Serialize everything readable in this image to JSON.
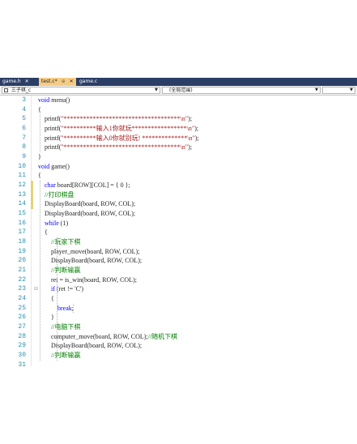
{
  "tabs": [
    {
      "label": "game.h",
      "active": false
    },
    {
      "label": "test.c*",
      "active": true
    },
    {
      "label": "game.c",
      "active": false
    }
  ],
  "nav": {
    "project": "三子棋_c",
    "scope": "(全局范围)",
    "member": ""
  },
  "lines": [
    {
      "n": "3",
      "code": "void menu()"
    },
    {
      "n": "4",
      "code": "{"
    },
    {
      "n": "5",
      "code": "    printf(\"************************************\\n\");"
    },
    {
      "n": "6",
      "code": "    printf(\"**********输入1你就玩*****************\\n\");"
    },
    {
      "n": "7",
      "code": "    printf(\"**********输入0你就别玩! **************\\n\");"
    },
    {
      "n": "8",
      "code": "    printf(\"************************************\\n\");"
    },
    {
      "n": "9",
      "code": "}"
    },
    {
      "n": "10",
      "code": "void game()"
    },
    {
      "n": "11",
      "code": "{"
    },
    {
      "n": "12",
      "code": "    char board[ROW][COL] = { 0 };"
    },
    {
      "n": "13",
      "code": "    //打印棋盘"
    },
    {
      "n": "14",
      "code": "    DisplayBoard(board, ROW, COL);"
    },
    {
      "n": "15",
      "code": "    DisplayBoard(board, ROW, COL);"
    },
    {
      "n": "16",
      "code": "    while (1)"
    },
    {
      "n": "17",
      "code": "    {"
    },
    {
      "n": "18",
      "code": "        //玩家下棋"
    },
    {
      "n": "19",
      "code": "        player_move(board, ROW, COL);"
    },
    {
      "n": "20",
      "code": "        DisplayBoard(board, ROW, COL);"
    },
    {
      "n": "21",
      "code": "        //判断输赢"
    },
    {
      "n": "22",
      "code": "        ret = is_win(board, ROW, COL);"
    },
    {
      "n": "23",
      "code": "        if (ret != 'C')"
    },
    {
      "n": "24",
      "code": "        {"
    },
    {
      "n": "25",
      "code": "            break;"
    },
    {
      "n": "26",
      "code": "        }"
    },
    {
      "n": "27",
      "code": "        //电脑下棋"
    },
    {
      "n": "28",
      "code": "        computer_move(board, ROW, COL);//随机下棋"
    },
    {
      "n": "29",
      "code": "        DisplayBoard(board, ROW, COL);"
    },
    {
      "n": "30",
      "code": "        //判断输赢"
    },
    {
      "n": "31",
      "code": ""
    }
  ],
  "colors": {
    "tabbar": "#2b3e66",
    "active_tab": "#f5cc84",
    "line_number": "#2b91af",
    "keyword": "#0000ff",
    "string": "#a31515",
    "comment": "#008000"
  }
}
